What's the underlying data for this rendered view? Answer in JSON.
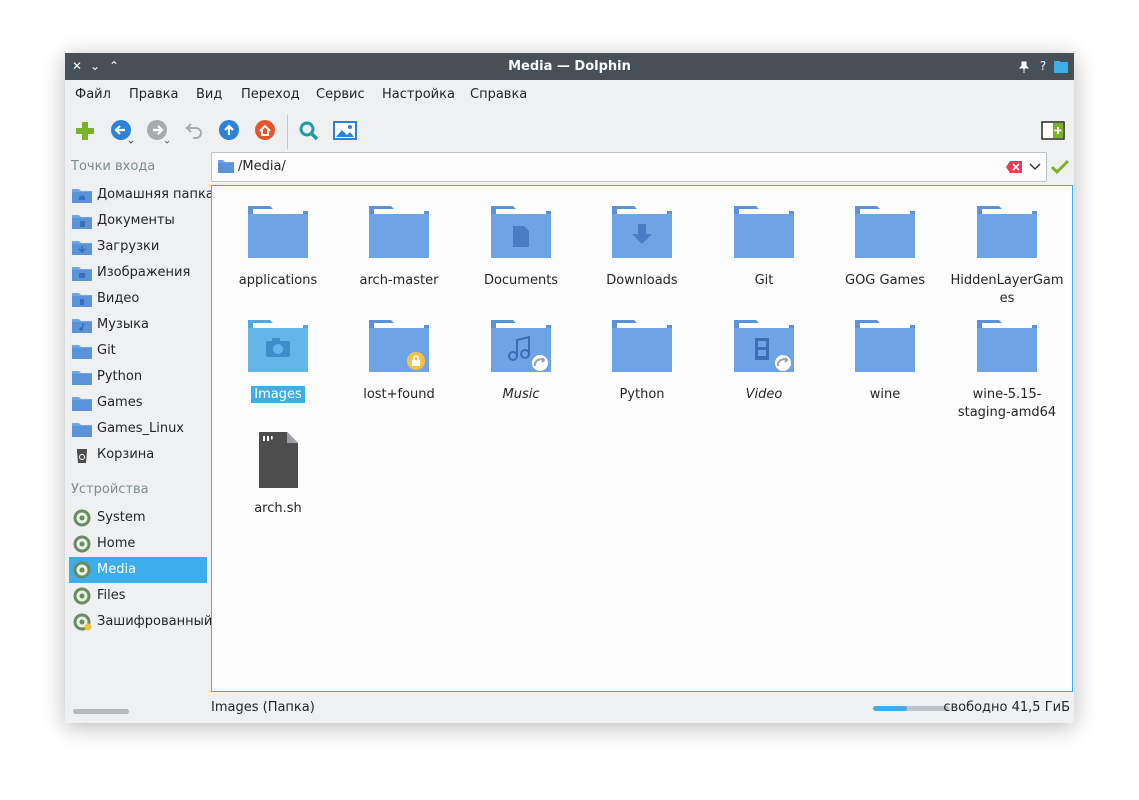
{
  "window": {
    "title": "Media — Dolphin",
    "controls": {
      "close": "✕",
      "minimize": "⌄",
      "maximize": "⌃",
      "pin": "📌",
      "help": "?"
    }
  },
  "menu": [
    "Файл",
    "Правка",
    "Вид",
    "Переход",
    "Сервис",
    "Настройка",
    "Справка"
  ],
  "toolbar": {
    "icons": [
      "new-tab-plus-icon",
      "back-icon",
      "forward-icon",
      "undo-icon",
      "up-icon",
      "home-icon",
      "search-icon",
      "preview-icon",
      "split-view-icon"
    ]
  },
  "places": {
    "header": "Точки входа",
    "items": [
      {
        "label": "Домашняя папка",
        "icon": "folder-home-icon"
      },
      {
        "label": "Документы",
        "icon": "folder-documents-icon"
      },
      {
        "label": "Загрузки",
        "icon": "folder-downloads-icon"
      },
      {
        "label": "Изображения",
        "icon": "folder-pictures-icon"
      },
      {
        "label": "Видео",
        "icon": "folder-videos-icon"
      },
      {
        "label": "Музыка",
        "icon": "folder-music-icon"
      },
      {
        "label": "Git",
        "icon": "folder-icon"
      },
      {
        "label": "Python",
        "icon": "folder-icon"
      },
      {
        "label": "Games",
        "icon": "folder-icon"
      },
      {
        "label": "Games_Linux",
        "icon": "folder-icon"
      },
      {
        "label": "Корзина",
        "icon": "trash-icon"
      }
    ]
  },
  "devices": {
    "header": "Устройства",
    "items": [
      {
        "label": "System",
        "icon": "drive-icon"
      },
      {
        "label": "Home",
        "icon": "drive-icon"
      },
      {
        "label": "Media",
        "icon": "drive-icon",
        "active": true
      },
      {
        "label": "Files",
        "icon": "drive-icon"
      },
      {
        "label": "Зашифрованный",
        "icon": "encrypted-drive-icon"
      }
    ]
  },
  "location": {
    "path": "/Media/"
  },
  "files": [
    {
      "name": "applications",
      "kind": "folder"
    },
    {
      "name": "arch-master",
      "kind": "folder"
    },
    {
      "name": "Documents",
      "kind": "folder-documents"
    },
    {
      "name": "Downloads",
      "kind": "folder-downloads"
    },
    {
      "name": "Git",
      "kind": "folder"
    },
    {
      "name": "GOG Games",
      "kind": "folder"
    },
    {
      "name": "HiddenLayerGam",
      "name2": "es",
      "kind": "folder"
    },
    {
      "name": "Images",
      "kind": "folder-pictures",
      "selected": true
    },
    {
      "name": "lost+found",
      "kind": "folder-locked"
    },
    {
      "name": "Music",
      "kind": "folder-music-link",
      "italic": true
    },
    {
      "name": "Python",
      "kind": "folder"
    },
    {
      "name": "Video",
      "kind": "folder-video-link",
      "italic": true
    },
    {
      "name": "wine",
      "kind": "folder"
    },
    {
      "name": "wine-5.15-",
      "name2": "staging-amd64",
      "kind": "folder"
    },
    {
      "name": "arch.sh",
      "kind": "script"
    }
  ],
  "status": {
    "text": "Images (Папка)",
    "free": "свободно 41,5 ГиБ",
    "used_fraction": 0.45
  },
  "colors": {
    "accent": "#3daee9",
    "folder": "#6ea3e6",
    "titlebar": "#475057"
  }
}
